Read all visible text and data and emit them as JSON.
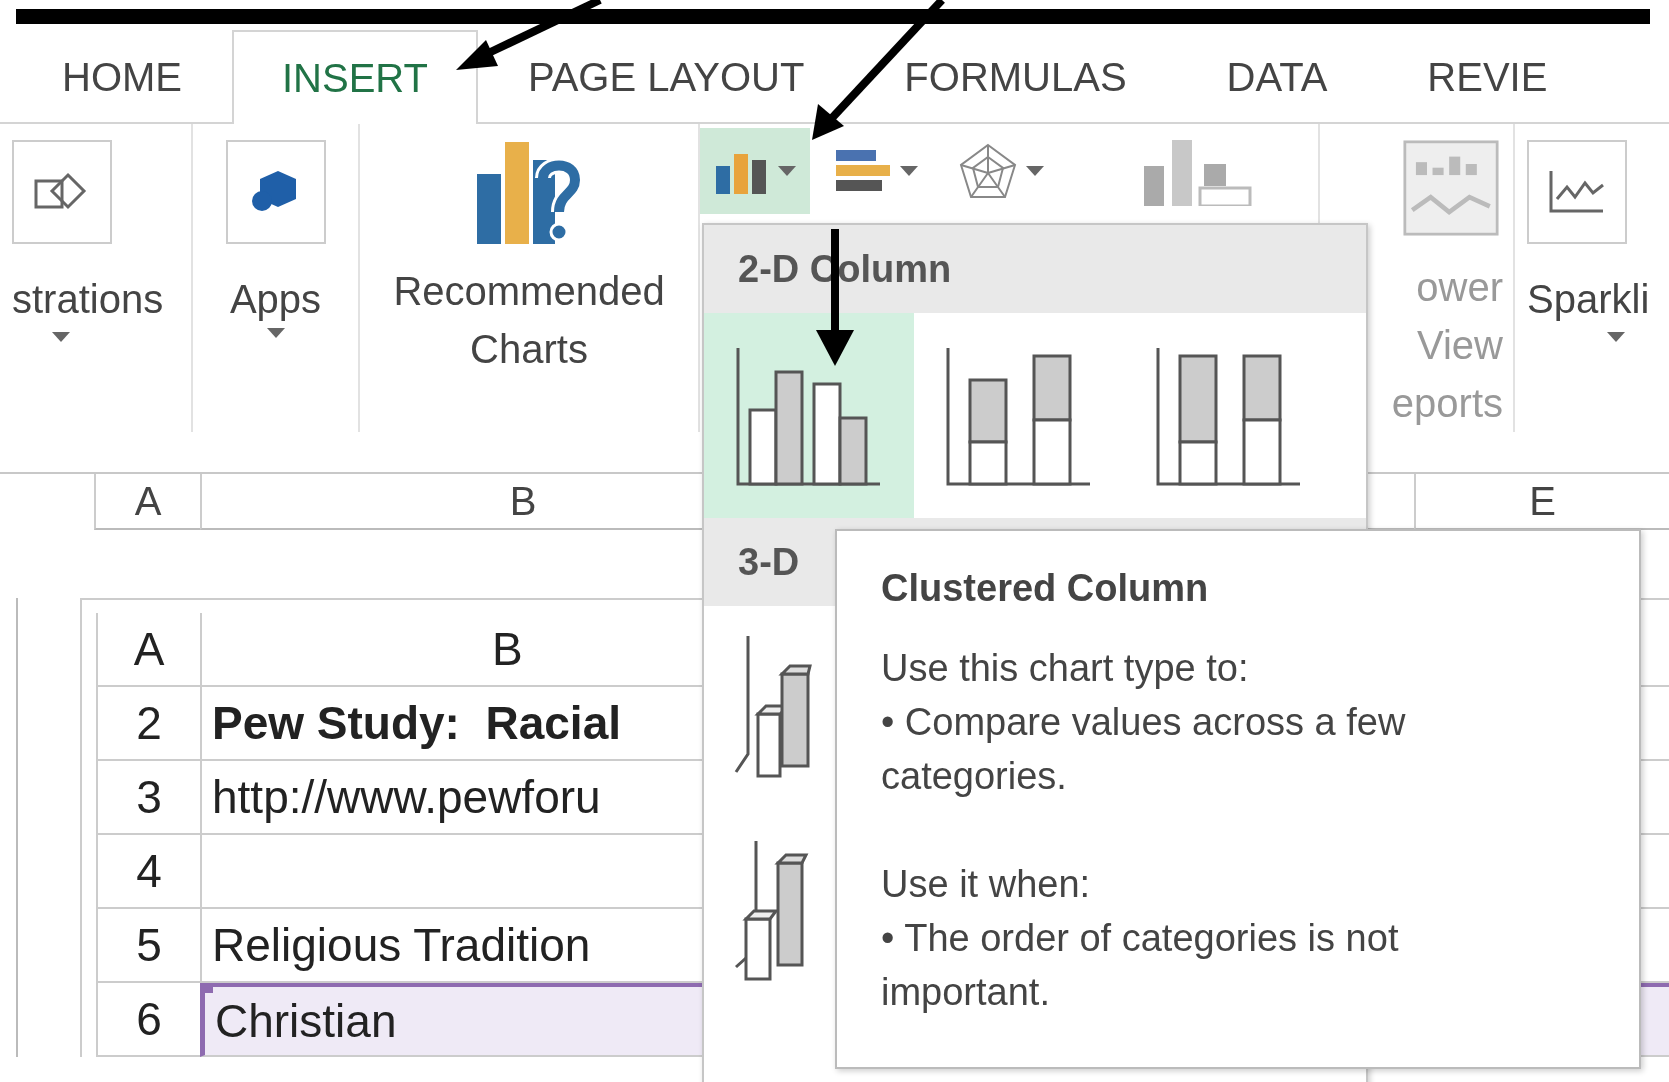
{
  "tabs": [
    {
      "label": "HOME",
      "selected": false
    },
    {
      "label": "INSERT",
      "selected": true
    },
    {
      "label": "PAGE LAYOUT",
      "selected": false
    },
    {
      "label": "FORMULAS",
      "selected": false
    },
    {
      "label": "DATA",
      "selected": false
    },
    {
      "label": "REVIE",
      "selected": false
    }
  ],
  "ribbon": {
    "illustrations": {
      "label": "strations"
    },
    "apps": {
      "label": "Apps"
    },
    "recommended_charts": {
      "label_lines": [
        "Recommended",
        "Charts"
      ]
    },
    "chart_buttons": [
      {
        "kind": "column",
        "selected": true
      },
      {
        "kind": "bar",
        "selected": false
      },
      {
        "kind": "radar",
        "selected": false
      },
      {
        "kind": "pivot",
        "selected": false
      }
    ],
    "power_view": {
      "label_lines": [
        "ower",
        "View",
        "eports"
      ]
    },
    "sparklines": {
      "label": "Sparkli"
    }
  },
  "column_headers": [
    "A",
    "B",
    "E"
  ],
  "sheet": {
    "columns": [
      "A",
      "B"
    ],
    "rows": [
      {
        "number": "2",
        "text": "Pew Study:  Racial",
        "bold": true,
        "selected": false
      },
      {
        "number": "3",
        "text": "http://www.pewforu",
        "bold": false,
        "selected": false
      },
      {
        "number": "4",
        "selected": false
      },
      {
        "number": "5",
        "text": "Religious Tradition",
        "bold": false,
        "selected": false
      },
      {
        "number": "6",
        "text": "Christian",
        "bold": false,
        "selected": true
      }
    ]
  },
  "menu": {
    "sections": [
      {
        "title": "2-D Column",
        "items": [
          {
            "kind": "clustered",
            "selected": true
          },
          {
            "kind": "stacked",
            "selected": false
          },
          {
            "kind": "stacked100",
            "selected": false
          }
        ]
      },
      {
        "title": "3-D",
        "items": [
          {
            "kind": "clustered3d",
            "selected": false
          },
          {
            "kind": "stacked3d",
            "selected": false
          }
        ]
      }
    ]
  },
  "tooltip": {
    "title": "Clustered Column",
    "paragraphs": [
      [
        "Use this chart type to:",
        "• Compare values across a few",
        "categories."
      ],
      [
        "Use it when:",
        "• The order of categories is not",
        "important."
      ]
    ]
  }
}
